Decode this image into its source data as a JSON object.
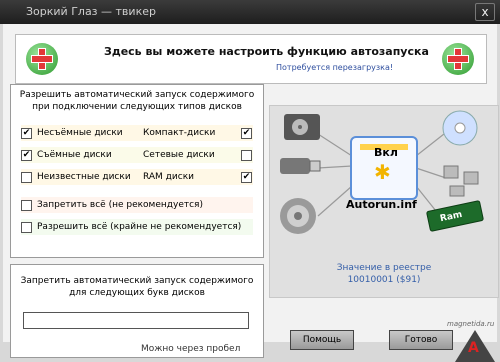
{
  "window": {
    "title": "Зоркий Глаз — твикер",
    "close_label": "x"
  },
  "header": {
    "title": "Здесь вы можете настроить функцию автозапуска",
    "subtitle": "Потребуется перезагрузка!"
  },
  "autorun_types": {
    "caption_line1": "Разрешить автоматический запуск содержимого",
    "caption_line2": "при подключении следующих типов дисков",
    "options": [
      {
        "label": "Несъёмные диски",
        "checked": true,
        "mark": "✔"
      },
      {
        "label": "Компакт-диски",
        "checked": true,
        "mark": "✔"
      },
      {
        "label": "Съёмные диски",
        "checked": true,
        "mark": "✔"
      },
      {
        "label": "Сетевые диски",
        "checked": false,
        "mark": ""
      },
      {
        "label": "Неизвестные диски",
        "checked": false,
        "mark": ""
      },
      {
        "label": "RAM диски",
        "checked": true,
        "mark": "✔"
      }
    ],
    "forbid_all": {
      "label": "Запретить всё (не рекомендуется)",
      "checked": false,
      "mark": ""
    },
    "allow_all": {
      "label": "Разрешить всё (крайне не рекомендуется)",
      "checked": false,
      "mark": ""
    }
  },
  "drive_letters": {
    "caption_line1": "Запретить автоматический запуск содержимого",
    "caption_line2": "для следующих букв дисков",
    "input_value": "",
    "hint": "Можно через пробел"
  },
  "diagram": {
    "status_label": "Вкл",
    "file_label": "Autorun.inf",
    "ram_label": "Ram",
    "registry_line1": "Значение в реестре",
    "registry_line2": "10010001 ($91)"
  },
  "buttons": {
    "help": "Помощь",
    "ok": "Готово"
  },
  "watermark": "magnetida.ru",
  "colors": {
    "titlebar": "#2a2a2a",
    "accent_blue": "#345ea8",
    "plus_green": "#2e9a2e",
    "plus_red": "#e23838"
  }
}
